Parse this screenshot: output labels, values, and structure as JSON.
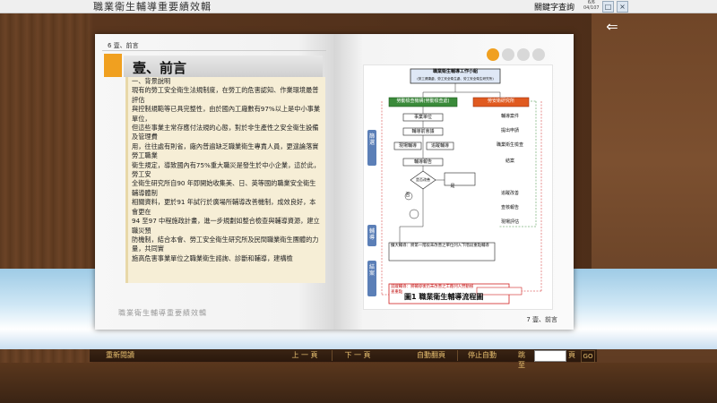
{
  "window": {
    "title": "職業衛生輔導重要績效輯",
    "search_label": "關鍵字查詢",
    "page_counter_top": "6/6",
    "page_counter_bottom": "04/107"
  },
  "left_page": {
    "header": "6 壹、前言",
    "section_title": "壹、前言",
    "paragraphs": [
      "一、背景說明",
      "現有的勞工安全衛生法規制度，在勞工的危害認知、作業環境最普評估",
      "與控制規範等已具完整性，由於國內工廠數有97%以上是中小事業單位，",
      "但這些事業主常存應付法規的心態，對於非生產性之安全衛生設備及管理費",
      "用，往往處有則省，廠內普遍缺乏職業衛生專責人員，更遑論落實勞工職業",
      "衛生規定，導致國內有75%重大職災是發生於中小企業，這於此，勞工安",
      "全衛生研究所自90 年即開始收集美、日、英等國的職業安全衛生輔導體制",
      "相關資料，更於91 年試行於廣場所輔導改善機制，成效良好，本會更在",
      "94 至97 中程施政計畫，進一步規劃如整合檢查與輔導資源，建立職災預",
      "防機制，結合本會、勞工安全衛生研究所及民間職業衛生團體的力量，共同實",
      "施高危害事業單位之職業衛生諮詢、診斷和輔導，建構檢"
    ],
    "footer": "職業衛生輔導重要績效輯"
  },
  "right_page": {
    "footer": "7 壹、前言",
    "caption": "圖1 職業衛生輔導流程圖",
    "diagram": {
      "top_box": "職業衛生輔導工作小組",
      "top_sub": "(勞工健康處、勞工安全衛生處、勞工安全衛生研究所)",
      "left_branch": "勞動檢查機構(勞動檢查處)",
      "right_branch": "勞安衛研究所",
      "steps": [
        "事業單位",
        "輔導前會議",
        "現場輔導",
        "輔導報告",
        "追蹤輔導"
      ],
      "side_labels": [
        "輔導案件",
        "提出申請",
        "職業衛生檢查",
        "現場評估",
        "追蹤改善",
        "查核報告",
        "結案"
      ],
      "diamond": "是否改善",
      "yes": "是",
      "no": "否",
      "left_tabs": [
        "篩選",
        "輔導",
        "結案"
      ],
      "vert_label": "勞動檢查機構轉介",
      "bottom_box": "擴大輔導：將第一階段未改善之單位列入下階段重點輔導",
      "bottom_box2": "追蹤輔導：將輔導後仍未改善之工廠列入勞動檢查重點"
    }
  },
  "pager_dots": 4,
  "toolbar": {
    "restart": "重新閱讀",
    "prev": "上 一 頁",
    "next": "下 一 頁",
    "autoplay": "自動翻頁",
    "stop": "停止自動",
    "goto_label": "跳至",
    "goto_suffix": "頁",
    "go": "GO"
  },
  "colors": {
    "accent": "#f0a020",
    "wood": "#5a361e",
    "toolbar_text": "#e8c070"
  }
}
